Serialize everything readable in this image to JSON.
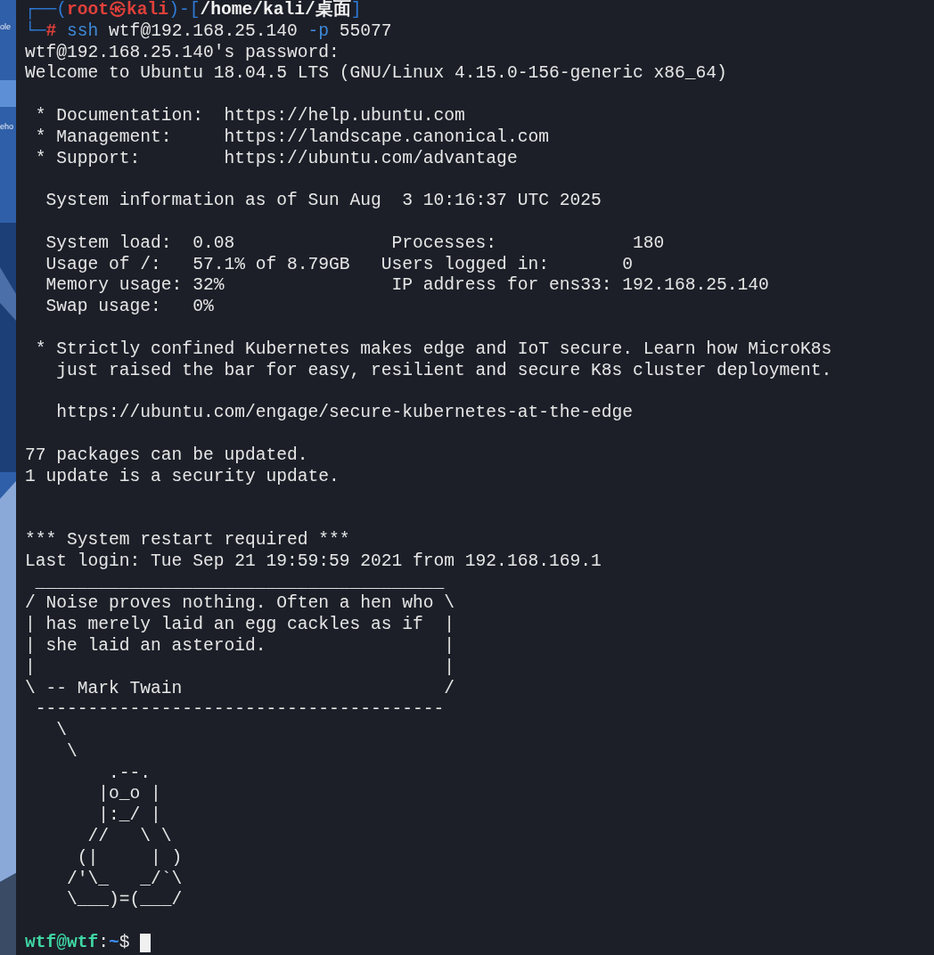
{
  "desktop": {
    "icon_labels": [
      "ole",
      "eho"
    ]
  },
  "terminal": {
    "lines": [
      {
        "kind": "styled",
        "segments": [
          {
            "text": "┌──(",
            "kind": "frame"
          },
          {
            "text": "root㉿kali",
            "kind": "root"
          },
          {
            "text": ")-[",
            "kind": "frame"
          },
          {
            "text": "/home/kali/桌面",
            "kind": "path"
          },
          {
            "text": "]",
            "kind": "frame"
          }
        ]
      },
      {
        "kind": "styled",
        "segments": [
          {
            "text": "└─",
            "kind": "frame"
          },
          {
            "text": "#",
            "kind": "root"
          },
          {
            "text": " ssh",
            "kind": "command"
          },
          {
            "text": " wtf@192.168.25.140 ",
            "kind": "plain"
          },
          {
            "text": "-p",
            "kind": "command"
          },
          {
            "text": " 55077",
            "kind": "plain"
          }
        ]
      },
      {
        "kind": "text",
        "text": "wtf@192.168.25.140's password:"
      },
      {
        "kind": "text",
        "text": "Welcome to Ubuntu 18.04.5 LTS (GNU/Linux 4.15.0-156-generic x86_64)"
      },
      {
        "kind": "blank"
      },
      {
        "kind": "text",
        "text": " * Documentation:  https://help.ubuntu.com"
      },
      {
        "kind": "text",
        "text": " * Management:     https://landscape.canonical.com"
      },
      {
        "kind": "text",
        "text": " * Support:        https://ubuntu.com/advantage"
      },
      {
        "kind": "blank"
      },
      {
        "kind": "text",
        "text": "  System information as of Sun Aug  3 10:16:37 UTC 2025"
      },
      {
        "kind": "blank"
      },
      {
        "kind": "text",
        "text": "  System load:  0.08               Processes:             180"
      },
      {
        "kind": "text",
        "text": "  Usage of /:   57.1% of 8.79GB   Users logged in:       0"
      },
      {
        "kind": "text",
        "text": "  Memory usage: 32%                IP address for ens33: 192.168.25.140"
      },
      {
        "kind": "text",
        "text": "  Swap usage:   0%"
      },
      {
        "kind": "blank"
      },
      {
        "kind": "text",
        "text": " * Strictly confined Kubernetes makes edge and IoT secure. Learn how MicroK8s"
      },
      {
        "kind": "text",
        "text": "   just raised the bar for easy, resilient and secure K8s cluster deployment."
      },
      {
        "kind": "blank"
      },
      {
        "kind": "text",
        "text": "   https://ubuntu.com/engage/secure-kubernetes-at-the-edge"
      },
      {
        "kind": "blank"
      },
      {
        "kind": "text",
        "text": "77 packages can be updated."
      },
      {
        "kind": "text",
        "text": "1 update is a security update."
      },
      {
        "kind": "blank"
      },
      {
        "kind": "blank"
      },
      {
        "kind": "text",
        "text": "*** System restart required ***"
      },
      {
        "kind": "text",
        "text": "Last login: Tue Sep 21 19:59:59 2021 from 192.168.169.1"
      },
      {
        "kind": "text",
        "text": " _______________________________________"
      },
      {
        "kind": "text",
        "text": "/ Noise proves nothing. Often a hen who \\"
      },
      {
        "kind": "text",
        "text": "| has merely laid an egg cackles as if  |"
      },
      {
        "kind": "text",
        "text": "| she laid an asteroid.                 |"
      },
      {
        "kind": "text",
        "text": "|                                       |"
      },
      {
        "kind": "text",
        "text": "\\ -- Mark Twain                         /"
      },
      {
        "kind": "text",
        "text": " ---------------------------------------"
      },
      {
        "kind": "text",
        "text": "   \\"
      },
      {
        "kind": "text",
        "text": "    \\"
      },
      {
        "kind": "text",
        "text": "        .--."
      },
      {
        "kind": "text",
        "text": "       |o_o |"
      },
      {
        "kind": "text",
        "text": "       |:_/ |"
      },
      {
        "kind": "text",
        "text": "      //   \\ \\"
      },
      {
        "kind": "text",
        "text": "     (|     | )"
      },
      {
        "kind": "text",
        "text": "    /'\\_   _/`\\"
      },
      {
        "kind": "text",
        "text": "    \\___)=(___/"
      },
      {
        "kind": "blank"
      },
      {
        "kind": "styled",
        "cursor": true,
        "segments": [
          {
            "text": "wtf@wtf",
            "kind": "user"
          },
          {
            "text": ":",
            "kind": "plain"
          },
          {
            "text": "~",
            "kind": "cwd"
          },
          {
            "text": "$ ",
            "kind": "plain"
          }
        ]
      }
    ]
  }
}
